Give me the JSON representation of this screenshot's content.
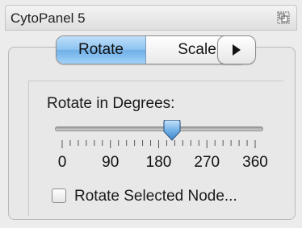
{
  "panel": {
    "title": "CytoPanel 5",
    "float_icon": "float-window-icon"
  },
  "tabs": [
    {
      "label": "Rotate",
      "selected": true
    },
    {
      "label": "Scale",
      "selected": false
    }
  ],
  "more_button": {
    "icon": "play-icon"
  },
  "rotate": {
    "label": "Rotate in Degrees:",
    "value": 205,
    "min": 0,
    "max": 360,
    "tick_labels": [
      "0",
      "90",
      "180",
      "270",
      "360"
    ]
  },
  "checkbox": {
    "label": "Rotate Selected Node...",
    "checked": false
  },
  "colors": {
    "selected_tab": "#8ec3f0",
    "panel_bg": "#ececec"
  }
}
